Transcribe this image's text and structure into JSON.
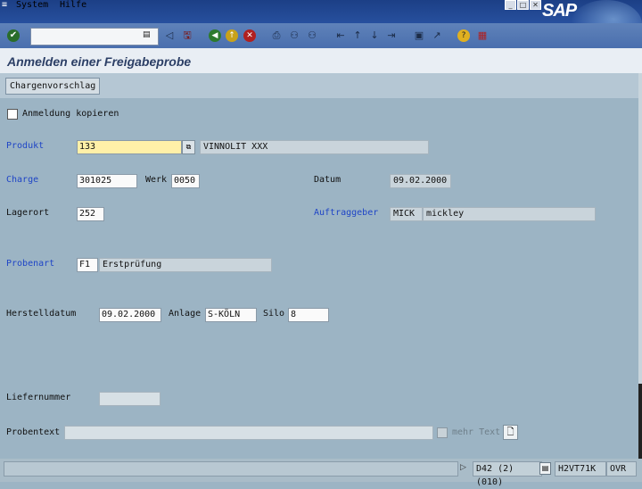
{
  "menu": {
    "items": [
      "System",
      "Hilfe"
    ]
  },
  "brand": {
    "logo_text": "SAP"
  },
  "window": {
    "title": "Anmelden einer Freigabeprobe"
  },
  "toolbar": {
    "command_field_value": "",
    "icons": [
      "enter-icon",
      "back-icon",
      "exit-icon",
      "cancel-icon",
      "save-icon",
      "print-icon",
      "find-icon",
      "find-next-icon",
      "first-page-icon",
      "prev-page-icon",
      "next-page-icon",
      "last-page-icon",
      "new-session-icon",
      "shortcut-icon",
      "help-icon",
      "layout-icon"
    ]
  },
  "app_toolbar": {
    "chargenvorschlag_label": "Chargenvorschlag"
  },
  "form": {
    "copy_checkbox_label": "Anmeldung kopieren",
    "produkt": {
      "label": "Produkt",
      "value": "133",
      "description": "VINNOLIT  XXX"
    },
    "charge": {
      "label": "Charge",
      "value": "301025"
    },
    "werk": {
      "label": "Werk",
      "value": "0050"
    },
    "datum": {
      "label": "Datum",
      "value": "09.02.2000"
    },
    "lagerort": {
      "label": "Lagerort",
      "value": "252"
    },
    "auftraggeber": {
      "label": "Auftraggeber",
      "value": "MICK",
      "description": "mickley"
    },
    "probenart": {
      "label": "Probenart",
      "value": "F1",
      "description": "Erstprüfung"
    },
    "herstelldatum": {
      "label": "Herstelldatum",
      "value": "09.02.2000"
    },
    "anlage": {
      "label": "Anlage",
      "value": "S-KÖLN"
    },
    "silo": {
      "label": "Silo",
      "value": "8"
    },
    "liefernummer": {
      "label": "Liefernummer",
      "value": ""
    },
    "probentext": {
      "label": "Probentext",
      "value": "",
      "more_text_label": "mehr Text"
    }
  },
  "status_bar": {
    "session": "D42 (2) (010)",
    "server": "H2VT71K",
    "mode": "OVR"
  },
  "colors": {
    "menubar": "#1c3f86",
    "title": "#2c3f66",
    "required_field": "#fff0a8",
    "blue_label": "#1f45c6"
  }
}
